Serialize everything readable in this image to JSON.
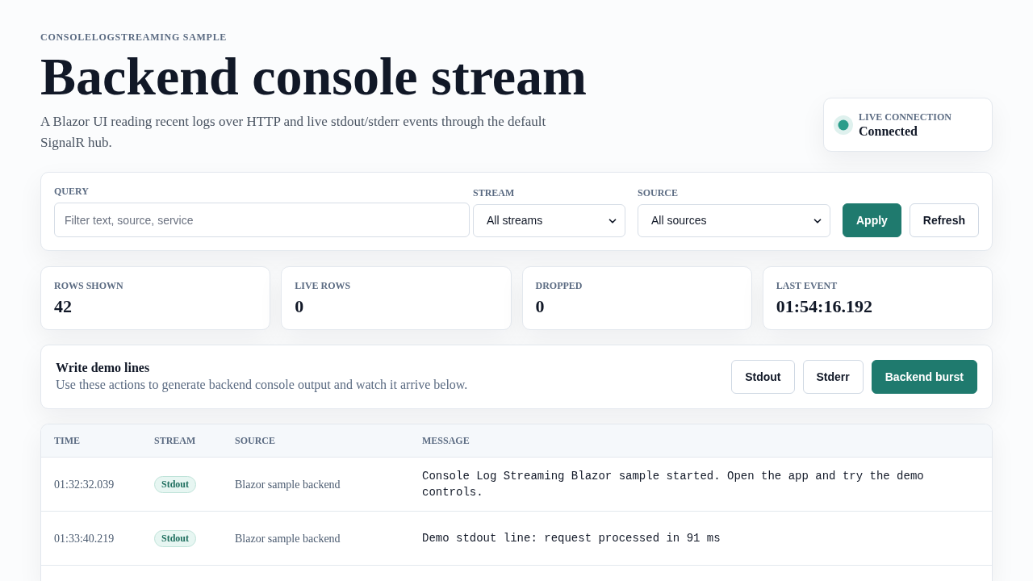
{
  "header": {
    "eyebrow": "CONSOLELOGSTREAMING SAMPLE",
    "title": "Backend console stream",
    "subtitle": "A Blazor UI reading recent logs over HTTP and live stdout/stderr events through the default SignalR hub."
  },
  "connection": {
    "label": "LIVE CONNECTION",
    "status": "Connected",
    "connected": true
  },
  "filters": {
    "query": {
      "label": "QUERY",
      "placeholder": "Filter text, source, service"
    },
    "stream": {
      "label": "STREAM",
      "value": "All streams"
    },
    "source": {
      "label": "SOURCE",
      "value": "All sources"
    },
    "buttons": [
      {
        "label": "Apply",
        "kind": "primary"
      },
      {
        "label": "Refresh",
        "kind": "secondary"
      }
    ]
  },
  "stats": [
    {
      "label": "ROWS SHOWN",
      "value": "42"
    },
    {
      "label": "LIVE ROWS",
      "value": "0"
    },
    {
      "label": "DROPPED",
      "value": "0"
    },
    {
      "label": "LAST EVENT",
      "value": "01:54:16.192"
    }
  ],
  "demo": {
    "title": "Write demo lines",
    "description": "Use these actions to generate backend console output and watch it arrive below.",
    "buttons": [
      {
        "label": "Stdout",
        "kind": "secondary"
      },
      {
        "label": "Stderr",
        "kind": "secondary"
      },
      {
        "label": "Backend burst",
        "kind": "primary"
      }
    ]
  },
  "table": {
    "columns": [
      "TIME",
      "STREAM",
      "SOURCE",
      "MESSAGE"
    ],
    "rows": [
      {
        "time": "01:32:32.039",
        "stream": "Stdout",
        "source": "Blazor sample backend",
        "message": "Console Log Streaming Blazor sample started. Open the app and try the demo controls."
      },
      {
        "time": "01:33:40.219",
        "stream": "Stdout",
        "source": "Blazor sample backend",
        "message": "Demo stdout line: request processed in 91 ms"
      }
    ]
  }
}
